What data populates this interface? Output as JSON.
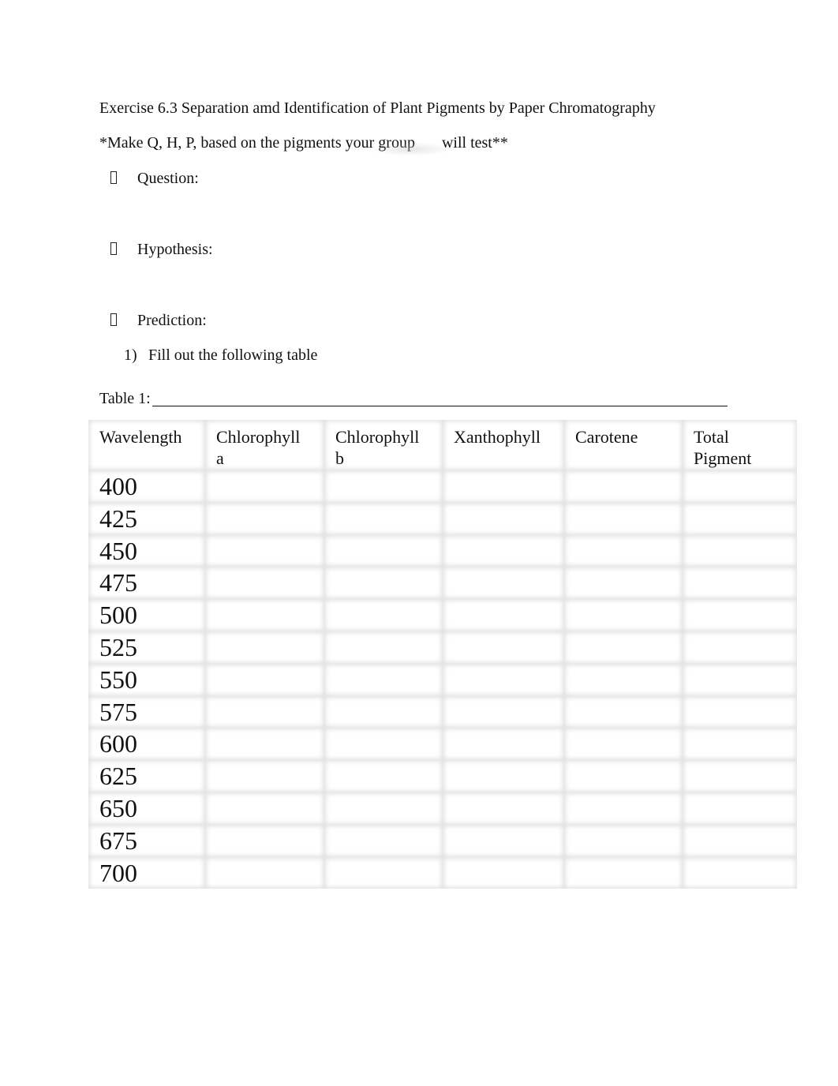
{
  "document": {
    "title": "Exercise 6.3 Separation amd Identification of Plant Pigments by Paper Chromatography",
    "instruction_part1": "*Make Q, H, P, based on the pigments your group",
    "instruction_part2": "will test**",
    "bullets": [
      {
        "icon": "missing-glyph-bullet",
        "label": "Question:"
      },
      {
        "icon": "missing-glyph-bullet",
        "label": "Hypothesis:"
      },
      {
        "icon": "missing-glyph-bullet",
        "label": "Prediction:"
      }
    ],
    "steps": [
      {
        "number": "1)",
        "text": "Fill out the following table"
      }
    ],
    "table_caption": "Table 1:"
  },
  "table": {
    "headers": [
      {
        "line1": "Wavelength",
        "line2": ""
      },
      {
        "line1": "Chlorophyll",
        "line2": "a"
      },
      {
        "line1": "Chlorophyll",
        "line2": "b"
      },
      {
        "line1": "Xanthophyll",
        "line2": ""
      },
      {
        "line1": "Carotene",
        "line2": ""
      },
      {
        "line1": "Total",
        "line2": "Pigment"
      }
    ],
    "rows": [
      {
        "wavelength": "400",
        "chlorophyll_a": "",
        "chlorophyll_b": "",
        "xanthophyll": "",
        "carotene": "",
        "total_pigment": ""
      },
      {
        "wavelength": "425",
        "chlorophyll_a": "",
        "chlorophyll_b": "",
        "xanthophyll": "",
        "carotene": "",
        "total_pigment": ""
      },
      {
        "wavelength": "450",
        "chlorophyll_a": "",
        "chlorophyll_b": "",
        "xanthophyll": "",
        "carotene": "",
        "total_pigment": ""
      },
      {
        "wavelength": "475",
        "chlorophyll_a": "",
        "chlorophyll_b": "",
        "xanthophyll": "",
        "carotene": "",
        "total_pigment": ""
      },
      {
        "wavelength": "500",
        "chlorophyll_a": "",
        "chlorophyll_b": "",
        "xanthophyll": "",
        "carotene": "",
        "total_pigment": ""
      },
      {
        "wavelength": "525",
        "chlorophyll_a": "",
        "chlorophyll_b": "",
        "xanthophyll": "",
        "carotene": "",
        "total_pigment": ""
      },
      {
        "wavelength": "550",
        "chlorophyll_a": "",
        "chlorophyll_b": "",
        "xanthophyll": "",
        "carotene": "",
        "total_pigment": ""
      },
      {
        "wavelength": "575",
        "chlorophyll_a": "",
        "chlorophyll_b": "",
        "xanthophyll": "",
        "carotene": "",
        "total_pigment": ""
      },
      {
        "wavelength": "600",
        "chlorophyll_a": "",
        "chlorophyll_b": "",
        "xanthophyll": "",
        "carotene": "",
        "total_pigment": ""
      },
      {
        "wavelength": "625",
        "chlorophyll_a": "",
        "chlorophyll_b": "",
        "xanthophyll": "",
        "carotene": "",
        "total_pigment": ""
      },
      {
        "wavelength": "650",
        "chlorophyll_a": "",
        "chlorophyll_b": "",
        "xanthophyll": "",
        "carotene": "",
        "total_pigment": ""
      },
      {
        "wavelength": "675",
        "chlorophyll_a": "",
        "chlorophyll_b": "",
        "xanthophyll": "",
        "carotene": "",
        "total_pigment": ""
      },
      {
        "wavelength": "700",
        "chlorophyll_a": "",
        "chlorophyll_b": "",
        "xanthophyll": "",
        "carotene": "",
        "total_pigment": ""
      }
    ]
  }
}
